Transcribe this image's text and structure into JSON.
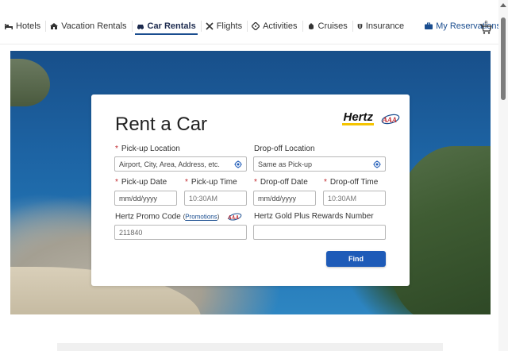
{
  "nav": {
    "items": [
      {
        "label": "Hotels",
        "icon": "bed-icon"
      },
      {
        "label": "Vacation Rentals",
        "icon": "house-icon"
      },
      {
        "label": "Car Rentals",
        "icon": "car-icon",
        "active": true
      },
      {
        "label": "Flights",
        "icon": "plane-icon"
      },
      {
        "label": "Activities",
        "icon": "ticket-icon"
      },
      {
        "label": "Cruises",
        "icon": "ship-icon"
      },
      {
        "label": "Insurance",
        "icon": "shield-icon"
      }
    ],
    "reservations": {
      "label": "My Reservations",
      "icon": "briefcase-icon"
    },
    "cart": {
      "icon": "cart-icon",
      "count": "0"
    }
  },
  "card": {
    "title": "Rent a Car",
    "brand": {
      "hertz": "Hertz",
      "aaa": "AAA"
    },
    "pickup_location": {
      "label": "Pick-up Location",
      "required": "*",
      "placeholder": "Airport, City, Area, Address, etc."
    },
    "dropoff_location": {
      "label": "Drop-off Location",
      "value": "Same as Pick-up"
    },
    "pickup_date": {
      "label": "Pick-up Date",
      "required": "*",
      "placeholder": "mm/dd/yyyy"
    },
    "pickup_time": {
      "label": "Pick-up Time",
      "required": "*",
      "value": "10:30AM"
    },
    "dropoff_date": {
      "label": "Drop-off Date",
      "required": "*",
      "placeholder": "mm/dd/yyyy"
    },
    "dropoff_time": {
      "label": "Drop-off Time",
      "required": "*",
      "value": "10:30AM"
    },
    "promo": {
      "label": "Hertz Promo Code",
      "paren_open": "(",
      "link": "Promotions",
      "paren_close": ")",
      "value": "211840"
    },
    "gold": {
      "label": "Hertz Gold Plus Rewards Number",
      "value": ""
    },
    "find_label": "Find"
  },
  "colors": {
    "accent": "#1e5bb8",
    "required": "#c0262d",
    "hertz_yellow": "#f5c400"
  }
}
